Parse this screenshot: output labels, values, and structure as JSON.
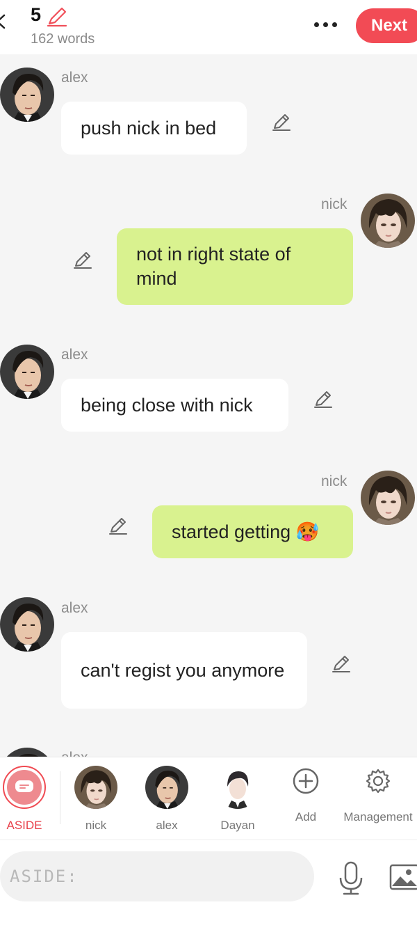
{
  "header": {
    "chapter_number": "5",
    "word_count": "162 words",
    "next_label": "Next"
  },
  "messages": [
    {
      "sender": "alex",
      "text": "push nick in bed",
      "side": "left"
    },
    {
      "sender": "nick",
      "text": "not in right state of mind",
      "side": "right"
    },
    {
      "sender": "alex",
      "text": "being close with nick",
      "side": "left"
    },
    {
      "sender": "nick",
      "text": "started getting 🥵",
      "side": "right"
    },
    {
      "sender": "alex",
      "text": "can't regist you anymore",
      "side": "left"
    },
    {
      "sender": "alex",
      "text": "",
      "side": "left"
    }
  ],
  "characters": [
    {
      "label": "ASIDE"
    },
    {
      "label": "nick"
    },
    {
      "label": "alex"
    },
    {
      "label": "Dayan"
    },
    {
      "label": "Add"
    },
    {
      "label": "Management"
    }
  ],
  "input": {
    "placeholder": "ASIDE:"
  },
  "colors": {
    "accent": "#f24b55",
    "bubble_right": "#d9f28f",
    "bubble_left": "#ffffff",
    "background": "#f5f5f5"
  },
  "icons": [
    "chevron-left-icon",
    "pencil-icon",
    "more-dots-icon",
    "plus-circle-icon",
    "gear-icon",
    "microphone-icon",
    "image-icon",
    "aside-chat-icon"
  ]
}
